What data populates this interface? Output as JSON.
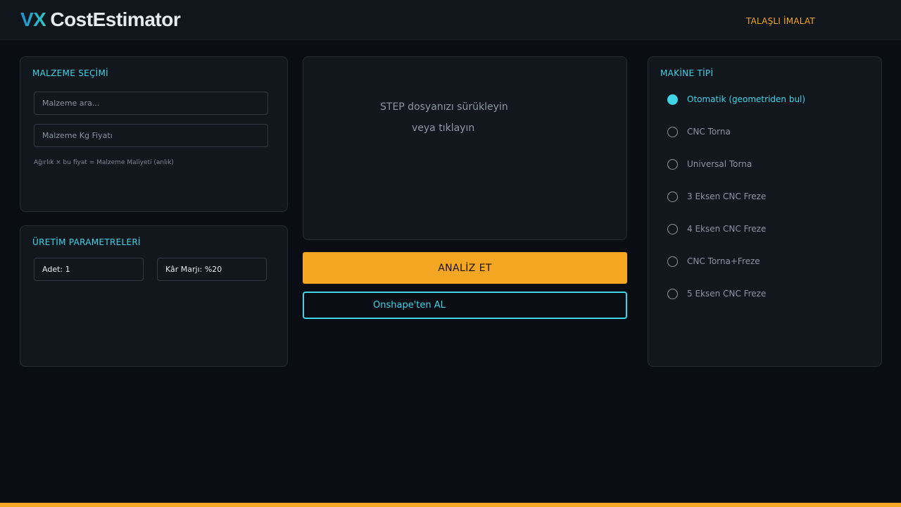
{
  "header": {
    "logo_mark": "VX",
    "logo_name": "CostEstimator",
    "mode": "TALAŞLI İMALAT"
  },
  "material": {
    "title": "MALZEME SEÇİMİ",
    "search_placeholder": "Malzeme ara...",
    "price_placeholder": "Malzeme Kg Fiyatı",
    "hint": "Ağırlık × bu fiyat = Malzeme Maliyeti (anlık)"
  },
  "production": {
    "title": "ÜRETİM PARAMETRELERİ",
    "quantity": "Adet: 1",
    "margin": "Kâr Marjı: %20"
  },
  "upload": {
    "line1": "STEP dosyanızı sürükleyin",
    "line2": "veya tıklayın",
    "analyze_label": "ANALİZ ET",
    "onshape_label": "Onshape'ten AL"
  },
  "machine": {
    "title": "MAKİNE TİPİ",
    "selected_index": 0,
    "options": [
      "Otomatik (geometriden bul)",
      "CNC Torna",
      "Universal Torna",
      "3 Eksen CNC Freze",
      "4 Eksen CNC Freze",
      "CNC Torna+Freze",
      "5 Eksen CNC Freze"
    ]
  },
  "colors": {
    "accent_cyan": "#3fd4e8",
    "accent_orange": "#f5a623",
    "background": "#0a0d13",
    "card": "#12161d"
  }
}
